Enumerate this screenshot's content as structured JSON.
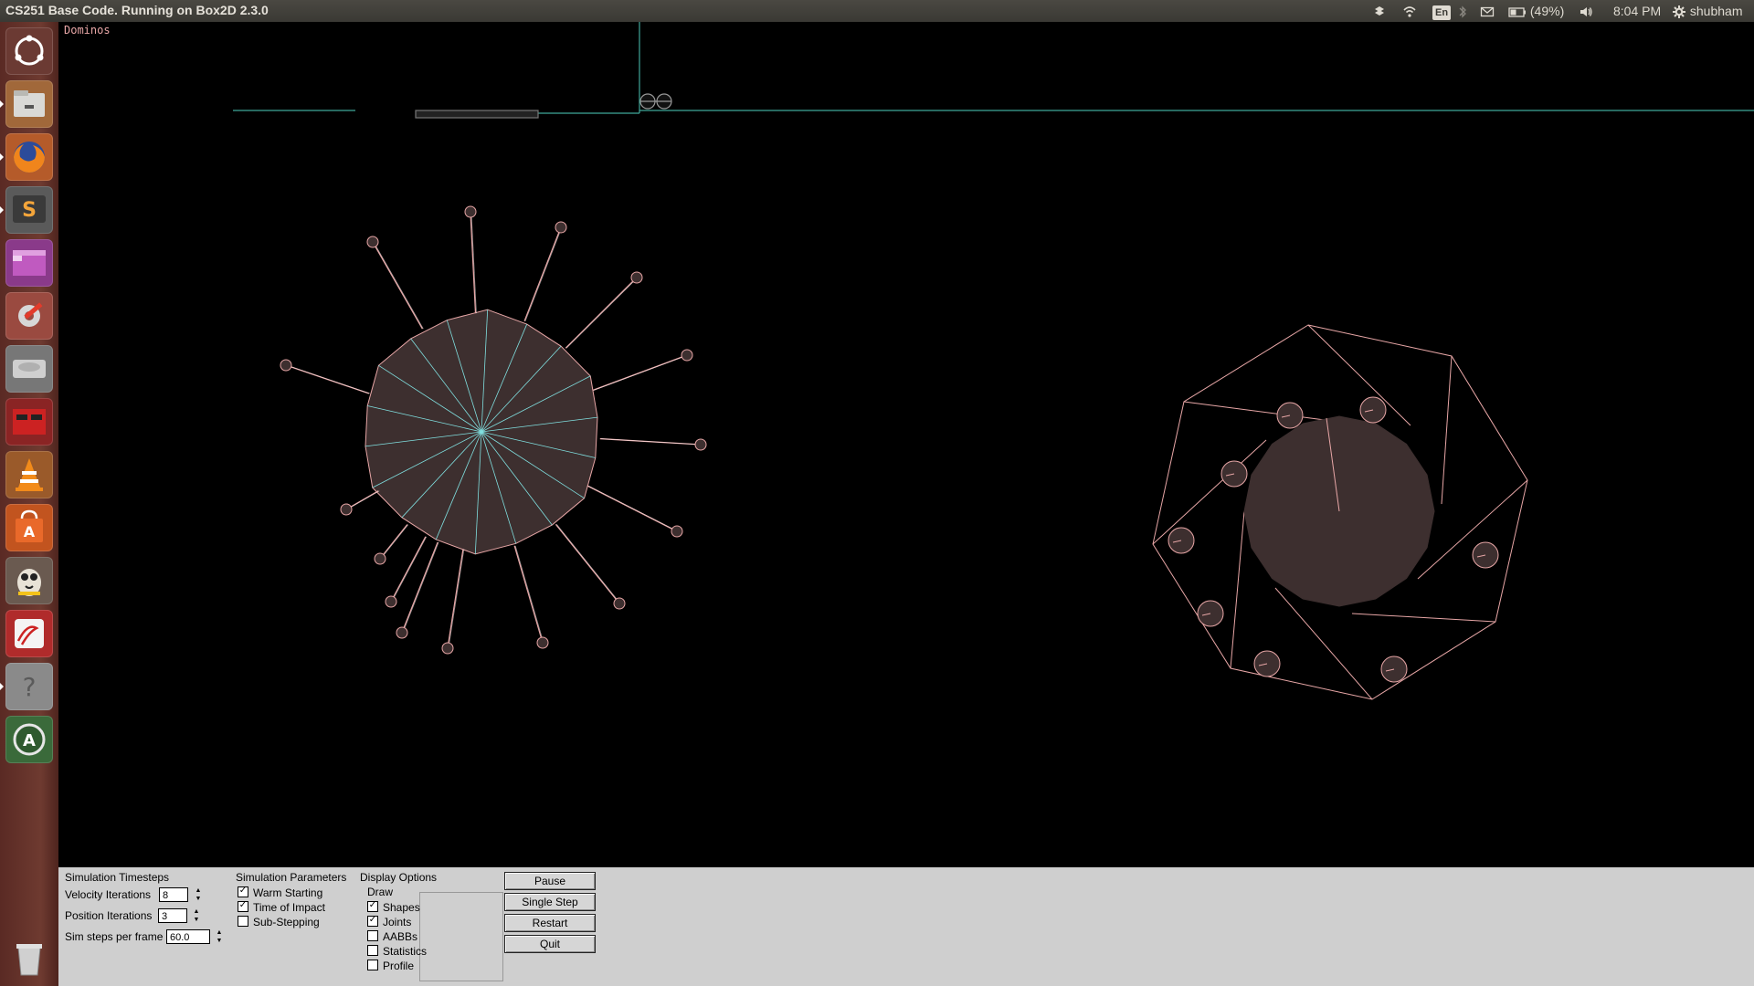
{
  "top_panel": {
    "window_title": "CS251 Base Code. Running on Box2D 2.3.0",
    "tray": {
      "keyboard_layout": "En",
      "battery": "(49%)",
      "time": "8:04 PM",
      "user": "shubham"
    }
  },
  "launcher": {
    "items": [
      {
        "name": "dash-home-icon"
      },
      {
        "name": "files-icon"
      },
      {
        "name": "firefox-icon"
      },
      {
        "name": "sublime-text-icon"
      },
      {
        "name": "workspace-switcher-icon"
      },
      {
        "name": "system-settings-icon"
      },
      {
        "name": "disk-icon"
      },
      {
        "name": "terminal-app-icon"
      },
      {
        "name": "vlc-icon"
      },
      {
        "name": "software-center-icon"
      },
      {
        "name": "pidgin-icon"
      },
      {
        "name": "document-viewer-icon"
      },
      {
        "name": "help-icon"
      },
      {
        "name": "software-updater-icon"
      }
    ],
    "trash": {
      "name": "trash-icon"
    }
  },
  "canvas": {
    "demo_label": "Dominos",
    "colors": {
      "shape_outline": "#e7a6a6",
      "shape_fill": "#3d2f2f",
      "joint": "#80e0e0",
      "ground": "#3fa89a"
    }
  },
  "controls": {
    "timesteps": {
      "title": "Simulation Timesteps",
      "velocity_label": "Velocity Iterations",
      "velocity_value": "8",
      "position_label": "Position Iterations",
      "position_value": "3",
      "steps_label": "Sim steps per frame",
      "steps_value": "60.0"
    },
    "parameters": {
      "title": "Simulation Parameters",
      "warm_starting": "Warm Starting",
      "time_of_impact": "Time of Impact",
      "sub_stepping": "Sub-Stepping"
    },
    "display": {
      "title": "Display Options",
      "draw_title": "Draw",
      "shapes": "Shapes",
      "joints": "Joints",
      "aabbs": "AABBs",
      "statistics": "Statistics",
      "profile": "Profile"
    },
    "buttons": {
      "pause": "Pause",
      "single_step": "Single Step",
      "restart": "Restart",
      "quit": "Quit"
    }
  }
}
